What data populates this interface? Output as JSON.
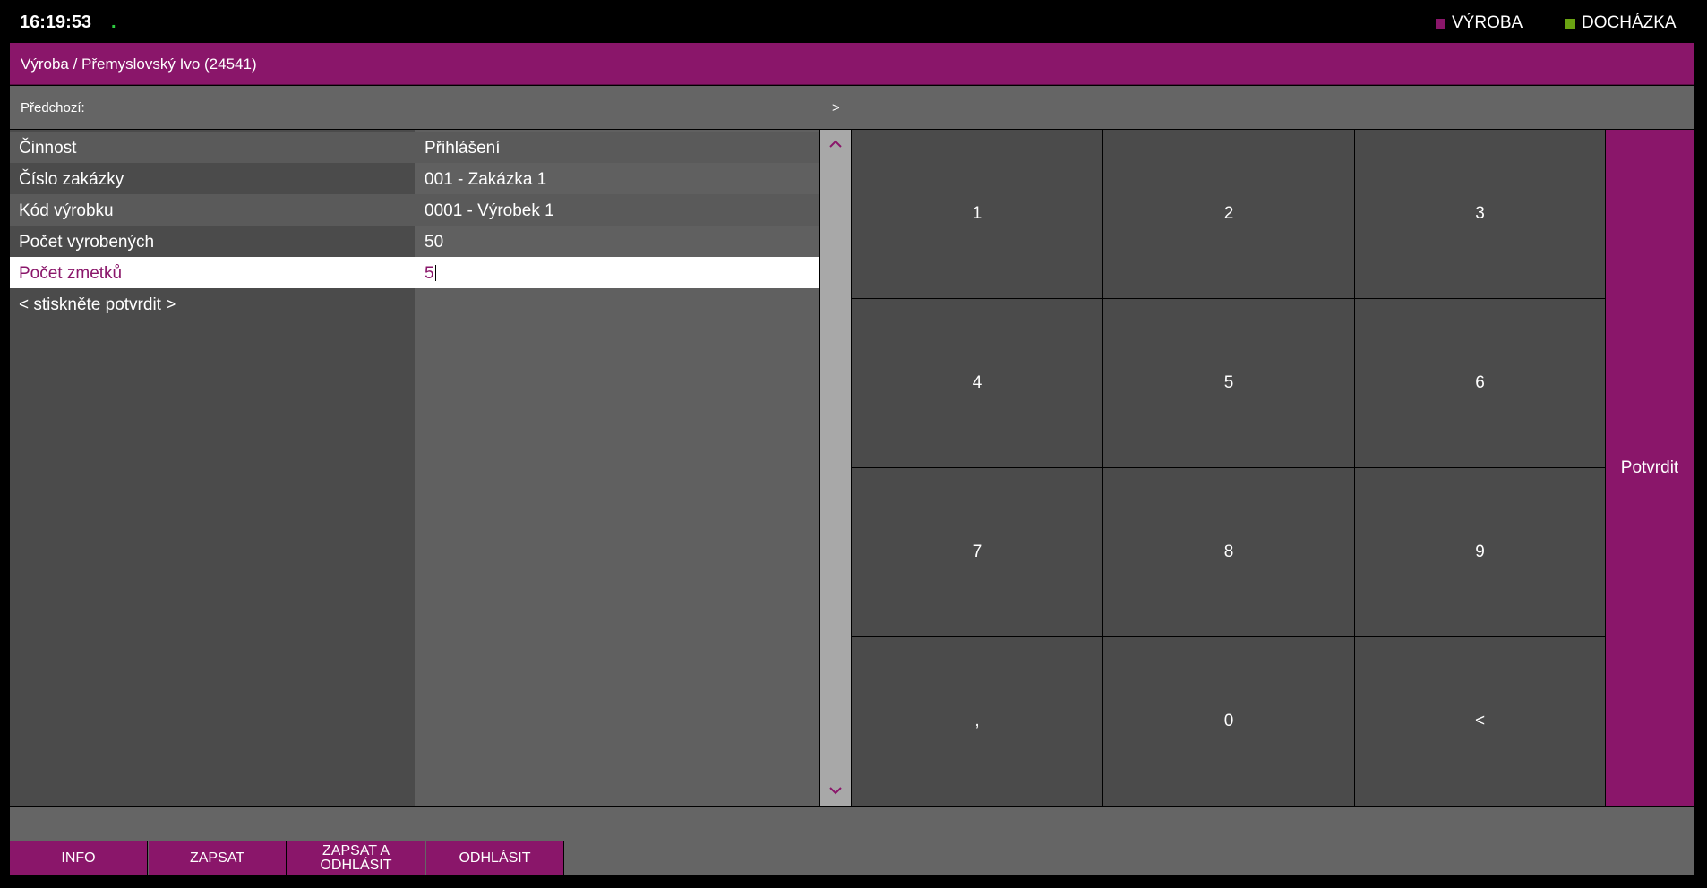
{
  "header": {
    "time": "16:19:53",
    "indicator": ".",
    "modes": [
      {
        "label": "VÝROBA",
        "color": "#8a166a"
      },
      {
        "label": "DOCHÁZKA",
        "color": "#6aa312"
      }
    ]
  },
  "title": "Výroba / Přemyslovský Ivo (24541)",
  "prev": {
    "label": "Předchozí:",
    "arrow": ">"
  },
  "form": {
    "rows": [
      {
        "label": "Činnost",
        "value": "Přihlášení"
      },
      {
        "label": "Číslo zakázky",
        "value": "001 - Zakázka 1"
      },
      {
        "label": "Kód výrobku",
        "value": "0001 - Výrobek 1"
      },
      {
        "label": "Počet vyrobených",
        "value": "50"
      },
      {
        "label": "Počet zmetků",
        "value": "5"
      },
      {
        "label": "< stiskněte potvrdit >",
        "value": ""
      }
    ]
  },
  "scroll": {
    "up": "^",
    "down": "v"
  },
  "keypad": {
    "keys": [
      "1",
      "2",
      "3",
      "4",
      "5",
      "6",
      "7",
      "8",
      "9",
      ",",
      "0",
      "<"
    ]
  },
  "confirm_label": "Potvrdit",
  "bottom_buttons": [
    "INFO",
    "ZAPSAT",
    "ZAPSAT A ODHLÁSIT",
    "ODHLÁSIT"
  ],
  "colors": {
    "accent": "#8a166a",
    "attendance": "#6aa312"
  }
}
